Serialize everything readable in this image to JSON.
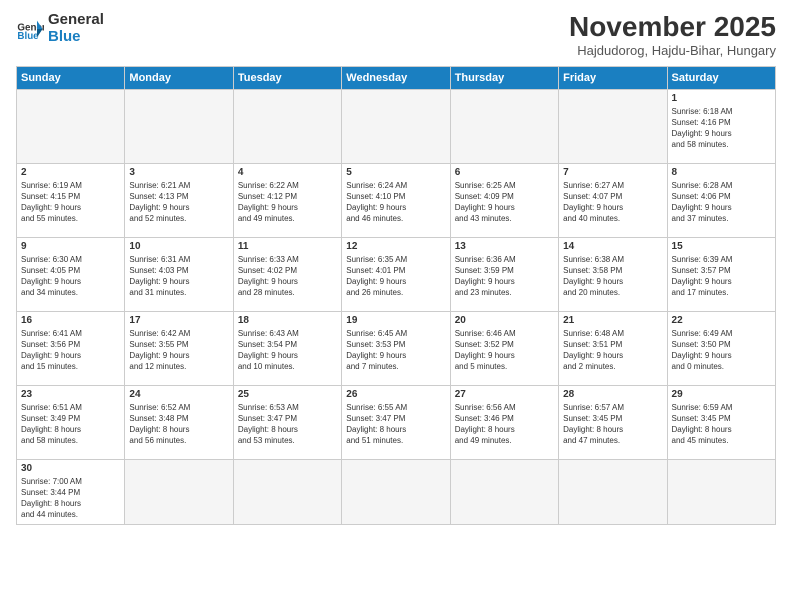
{
  "logo": {
    "text_general": "General",
    "text_blue": "Blue"
  },
  "header": {
    "month": "November 2025",
    "location": "Hajdudorog, Hajdu-Bihar, Hungary"
  },
  "weekdays": [
    "Sunday",
    "Monday",
    "Tuesday",
    "Wednesday",
    "Thursday",
    "Friday",
    "Saturday"
  ],
  "weeks": [
    [
      {
        "day": "",
        "info": ""
      },
      {
        "day": "",
        "info": ""
      },
      {
        "day": "",
        "info": ""
      },
      {
        "day": "",
        "info": ""
      },
      {
        "day": "",
        "info": ""
      },
      {
        "day": "",
        "info": ""
      },
      {
        "day": "1",
        "info": "Sunrise: 6:18 AM\nSunset: 4:16 PM\nDaylight: 9 hours\nand 58 minutes."
      }
    ],
    [
      {
        "day": "2",
        "info": "Sunrise: 6:19 AM\nSunset: 4:15 PM\nDaylight: 9 hours\nand 55 minutes."
      },
      {
        "day": "3",
        "info": "Sunrise: 6:21 AM\nSunset: 4:13 PM\nDaylight: 9 hours\nand 52 minutes."
      },
      {
        "day": "4",
        "info": "Sunrise: 6:22 AM\nSunset: 4:12 PM\nDaylight: 9 hours\nand 49 minutes."
      },
      {
        "day": "5",
        "info": "Sunrise: 6:24 AM\nSunset: 4:10 PM\nDaylight: 9 hours\nand 46 minutes."
      },
      {
        "day": "6",
        "info": "Sunrise: 6:25 AM\nSunset: 4:09 PM\nDaylight: 9 hours\nand 43 minutes."
      },
      {
        "day": "7",
        "info": "Sunrise: 6:27 AM\nSunset: 4:07 PM\nDaylight: 9 hours\nand 40 minutes."
      },
      {
        "day": "8",
        "info": "Sunrise: 6:28 AM\nSunset: 4:06 PM\nDaylight: 9 hours\nand 37 minutes."
      }
    ],
    [
      {
        "day": "9",
        "info": "Sunrise: 6:30 AM\nSunset: 4:05 PM\nDaylight: 9 hours\nand 34 minutes."
      },
      {
        "day": "10",
        "info": "Sunrise: 6:31 AM\nSunset: 4:03 PM\nDaylight: 9 hours\nand 31 minutes."
      },
      {
        "day": "11",
        "info": "Sunrise: 6:33 AM\nSunset: 4:02 PM\nDaylight: 9 hours\nand 28 minutes."
      },
      {
        "day": "12",
        "info": "Sunrise: 6:35 AM\nSunset: 4:01 PM\nDaylight: 9 hours\nand 26 minutes."
      },
      {
        "day": "13",
        "info": "Sunrise: 6:36 AM\nSunset: 3:59 PM\nDaylight: 9 hours\nand 23 minutes."
      },
      {
        "day": "14",
        "info": "Sunrise: 6:38 AM\nSunset: 3:58 PM\nDaylight: 9 hours\nand 20 minutes."
      },
      {
        "day": "15",
        "info": "Sunrise: 6:39 AM\nSunset: 3:57 PM\nDaylight: 9 hours\nand 17 minutes."
      }
    ],
    [
      {
        "day": "16",
        "info": "Sunrise: 6:41 AM\nSunset: 3:56 PM\nDaylight: 9 hours\nand 15 minutes."
      },
      {
        "day": "17",
        "info": "Sunrise: 6:42 AM\nSunset: 3:55 PM\nDaylight: 9 hours\nand 12 minutes."
      },
      {
        "day": "18",
        "info": "Sunrise: 6:43 AM\nSunset: 3:54 PM\nDaylight: 9 hours\nand 10 minutes."
      },
      {
        "day": "19",
        "info": "Sunrise: 6:45 AM\nSunset: 3:53 PM\nDaylight: 9 hours\nand 7 minutes."
      },
      {
        "day": "20",
        "info": "Sunrise: 6:46 AM\nSunset: 3:52 PM\nDaylight: 9 hours\nand 5 minutes."
      },
      {
        "day": "21",
        "info": "Sunrise: 6:48 AM\nSunset: 3:51 PM\nDaylight: 9 hours\nand 2 minutes."
      },
      {
        "day": "22",
        "info": "Sunrise: 6:49 AM\nSunset: 3:50 PM\nDaylight: 9 hours\nand 0 minutes."
      }
    ],
    [
      {
        "day": "23",
        "info": "Sunrise: 6:51 AM\nSunset: 3:49 PM\nDaylight: 8 hours\nand 58 minutes."
      },
      {
        "day": "24",
        "info": "Sunrise: 6:52 AM\nSunset: 3:48 PM\nDaylight: 8 hours\nand 56 minutes."
      },
      {
        "day": "25",
        "info": "Sunrise: 6:53 AM\nSunset: 3:47 PM\nDaylight: 8 hours\nand 53 minutes."
      },
      {
        "day": "26",
        "info": "Sunrise: 6:55 AM\nSunset: 3:47 PM\nDaylight: 8 hours\nand 51 minutes."
      },
      {
        "day": "27",
        "info": "Sunrise: 6:56 AM\nSunset: 3:46 PM\nDaylight: 8 hours\nand 49 minutes."
      },
      {
        "day": "28",
        "info": "Sunrise: 6:57 AM\nSunset: 3:45 PM\nDaylight: 8 hours\nand 47 minutes."
      },
      {
        "day": "29",
        "info": "Sunrise: 6:59 AM\nSunset: 3:45 PM\nDaylight: 8 hours\nand 45 minutes."
      }
    ],
    [
      {
        "day": "30",
        "info": "Sunrise: 7:00 AM\nSunset: 3:44 PM\nDaylight: 8 hours\nand 44 minutes."
      },
      {
        "day": "",
        "info": ""
      },
      {
        "day": "",
        "info": ""
      },
      {
        "day": "",
        "info": ""
      },
      {
        "day": "",
        "info": ""
      },
      {
        "day": "",
        "info": ""
      },
      {
        "day": "",
        "info": ""
      }
    ]
  ]
}
